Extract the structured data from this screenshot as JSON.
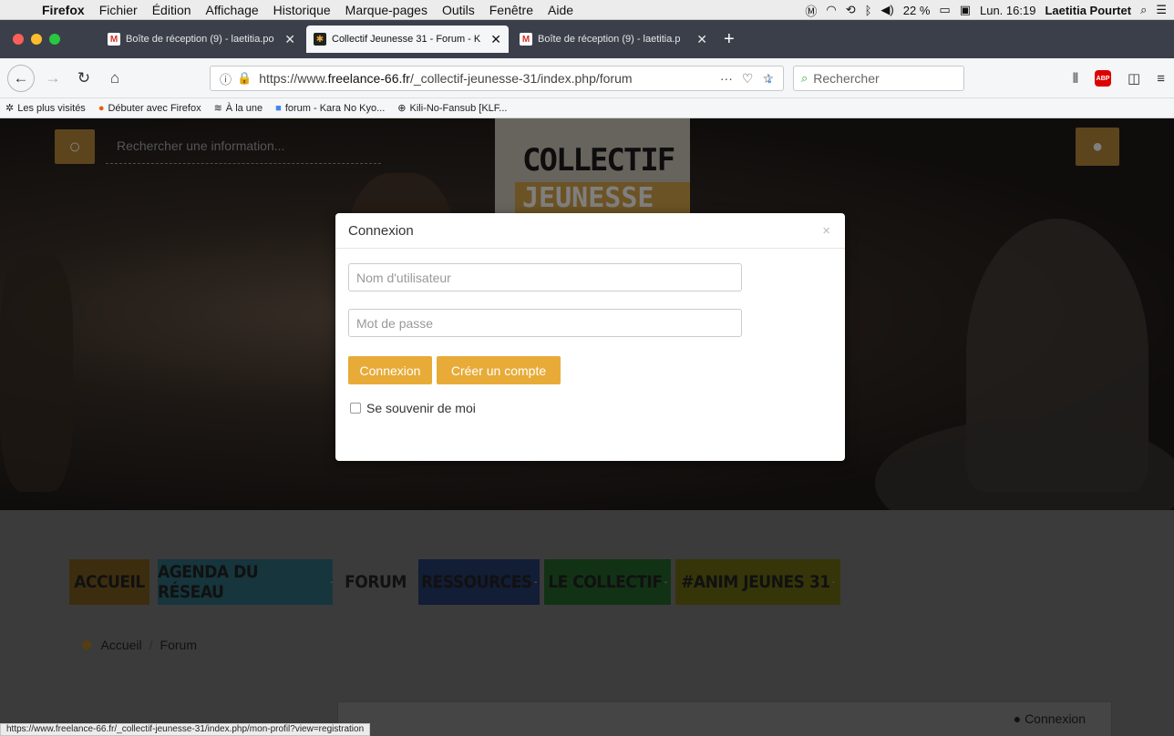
{
  "menubar": {
    "items": [
      "Firefox",
      "Fichier",
      "Édition",
      "Affichage",
      "Historique",
      "Marque-pages",
      "Outils",
      "Fenêtre",
      "Aide"
    ],
    "battery": "22 %",
    "clock": "Lun. 16:19",
    "user": "Laetitia Pourtet"
  },
  "tabs": [
    {
      "title": "Boîte de réception (9) - laetitia.po",
      "close": "✕"
    },
    {
      "title": "Collectif Jeunesse 31 - Forum - K",
      "close": "✕"
    },
    {
      "title": "Boîte de réception (9) - laetitia.p",
      "close": "✕"
    }
  ],
  "navbar": {
    "url_prefix": "https://www.",
    "url_domain": "freelance-66.fr",
    "url_path": "/_collectif-jeunesse-31/index.php/forum",
    "search_placeholder": "Rechercher"
  },
  "bookmarks": [
    {
      "label": "Les plus visités",
      "icon": "star-icon"
    },
    {
      "label": "Débuter avec Firefox",
      "icon": "firefox-icon"
    },
    {
      "label": "À la une",
      "icon": "rss-icon"
    },
    {
      "label": "forum - Kara No Kyo...",
      "icon": "google-icon"
    },
    {
      "label": "Kili-No-Fansub [KLF...",
      "icon": "globe-icon"
    }
  ],
  "hero": {
    "search_placeholder": "Rechercher une information...",
    "poster_line1": "COLLECTIF",
    "poster_line2": "JEUNESSE 31"
  },
  "nav": [
    {
      "label": "ACCUEIL",
      "color": "#7a5a1e",
      "dropdown": false
    },
    {
      "label": "AGENDA DU RÉSEAU",
      "color": "#2c6b78",
      "dropdown": true
    },
    {
      "label": "FORUM",
      "color": "",
      "dropdown": false
    },
    {
      "label": "RESSOURCES",
      "color": "#243a6c",
      "dropdown": true
    },
    {
      "label": "LE COLLECTIF",
      "color": "#24642b",
      "dropdown": true
    },
    {
      "label": "#ANIM JEUNES 31",
      "color": "#6c6a13",
      "dropdown": true
    }
  ],
  "breadcrumb": {
    "home": "Accueil",
    "sep": "/",
    "current": "Forum"
  },
  "panel": {
    "connexion": "Connexion"
  },
  "modal": {
    "title": "Connexion",
    "close": "×",
    "username_placeholder": "Nom d'utilisateur",
    "password_placeholder": "Mot de passe",
    "login_button": "Connexion",
    "register_button": "Créer un compte",
    "remember_label": "Se souvenir de moi"
  },
  "statusbar": "https://www.freelance-66.fr/_collectif-jeunesse-31/index.php/mon-profil?view=registration"
}
